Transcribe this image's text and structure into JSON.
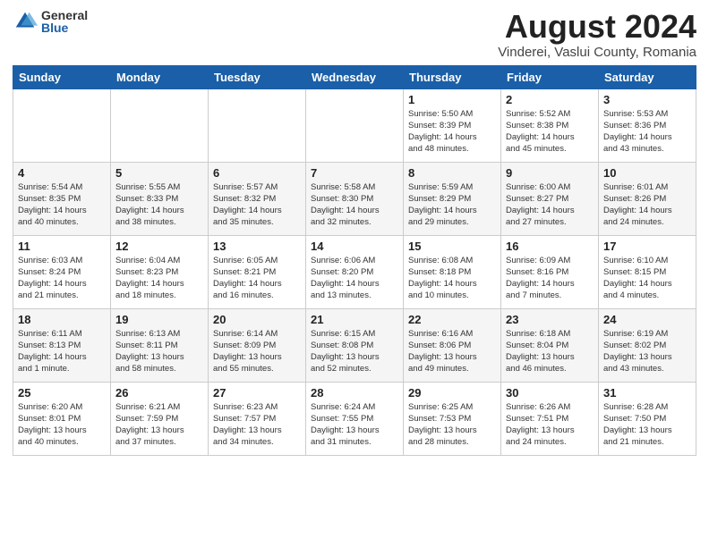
{
  "logo": {
    "general": "General",
    "blue": "Blue"
  },
  "title": "August 2024",
  "subtitle": "Vinderei, Vaslui County, Romania",
  "days_of_week": [
    "Sunday",
    "Monday",
    "Tuesday",
    "Wednesday",
    "Thursday",
    "Friday",
    "Saturday"
  ],
  "weeks": [
    [
      {
        "day": "",
        "info": ""
      },
      {
        "day": "",
        "info": ""
      },
      {
        "day": "",
        "info": ""
      },
      {
        "day": "",
        "info": ""
      },
      {
        "day": "1",
        "info": "Sunrise: 5:50 AM\nSunset: 8:39 PM\nDaylight: 14 hours\nand 48 minutes."
      },
      {
        "day": "2",
        "info": "Sunrise: 5:52 AM\nSunset: 8:38 PM\nDaylight: 14 hours\nand 45 minutes."
      },
      {
        "day": "3",
        "info": "Sunrise: 5:53 AM\nSunset: 8:36 PM\nDaylight: 14 hours\nand 43 minutes."
      }
    ],
    [
      {
        "day": "4",
        "info": "Sunrise: 5:54 AM\nSunset: 8:35 PM\nDaylight: 14 hours\nand 40 minutes."
      },
      {
        "day": "5",
        "info": "Sunrise: 5:55 AM\nSunset: 8:33 PM\nDaylight: 14 hours\nand 38 minutes."
      },
      {
        "day": "6",
        "info": "Sunrise: 5:57 AM\nSunset: 8:32 PM\nDaylight: 14 hours\nand 35 minutes."
      },
      {
        "day": "7",
        "info": "Sunrise: 5:58 AM\nSunset: 8:30 PM\nDaylight: 14 hours\nand 32 minutes."
      },
      {
        "day": "8",
        "info": "Sunrise: 5:59 AM\nSunset: 8:29 PM\nDaylight: 14 hours\nand 29 minutes."
      },
      {
        "day": "9",
        "info": "Sunrise: 6:00 AM\nSunset: 8:27 PM\nDaylight: 14 hours\nand 27 minutes."
      },
      {
        "day": "10",
        "info": "Sunrise: 6:01 AM\nSunset: 8:26 PM\nDaylight: 14 hours\nand 24 minutes."
      }
    ],
    [
      {
        "day": "11",
        "info": "Sunrise: 6:03 AM\nSunset: 8:24 PM\nDaylight: 14 hours\nand 21 minutes."
      },
      {
        "day": "12",
        "info": "Sunrise: 6:04 AM\nSunset: 8:23 PM\nDaylight: 14 hours\nand 18 minutes."
      },
      {
        "day": "13",
        "info": "Sunrise: 6:05 AM\nSunset: 8:21 PM\nDaylight: 14 hours\nand 16 minutes."
      },
      {
        "day": "14",
        "info": "Sunrise: 6:06 AM\nSunset: 8:20 PM\nDaylight: 14 hours\nand 13 minutes."
      },
      {
        "day": "15",
        "info": "Sunrise: 6:08 AM\nSunset: 8:18 PM\nDaylight: 14 hours\nand 10 minutes."
      },
      {
        "day": "16",
        "info": "Sunrise: 6:09 AM\nSunset: 8:16 PM\nDaylight: 14 hours\nand 7 minutes."
      },
      {
        "day": "17",
        "info": "Sunrise: 6:10 AM\nSunset: 8:15 PM\nDaylight: 14 hours\nand 4 minutes."
      }
    ],
    [
      {
        "day": "18",
        "info": "Sunrise: 6:11 AM\nSunset: 8:13 PM\nDaylight: 14 hours\nand 1 minute."
      },
      {
        "day": "19",
        "info": "Sunrise: 6:13 AM\nSunset: 8:11 PM\nDaylight: 13 hours\nand 58 minutes."
      },
      {
        "day": "20",
        "info": "Sunrise: 6:14 AM\nSunset: 8:09 PM\nDaylight: 13 hours\nand 55 minutes."
      },
      {
        "day": "21",
        "info": "Sunrise: 6:15 AM\nSunset: 8:08 PM\nDaylight: 13 hours\nand 52 minutes."
      },
      {
        "day": "22",
        "info": "Sunrise: 6:16 AM\nSunset: 8:06 PM\nDaylight: 13 hours\nand 49 minutes."
      },
      {
        "day": "23",
        "info": "Sunrise: 6:18 AM\nSunset: 8:04 PM\nDaylight: 13 hours\nand 46 minutes."
      },
      {
        "day": "24",
        "info": "Sunrise: 6:19 AM\nSunset: 8:02 PM\nDaylight: 13 hours\nand 43 minutes."
      }
    ],
    [
      {
        "day": "25",
        "info": "Sunrise: 6:20 AM\nSunset: 8:01 PM\nDaylight: 13 hours\nand 40 minutes."
      },
      {
        "day": "26",
        "info": "Sunrise: 6:21 AM\nSunset: 7:59 PM\nDaylight: 13 hours\nand 37 minutes."
      },
      {
        "day": "27",
        "info": "Sunrise: 6:23 AM\nSunset: 7:57 PM\nDaylight: 13 hours\nand 34 minutes."
      },
      {
        "day": "28",
        "info": "Sunrise: 6:24 AM\nSunset: 7:55 PM\nDaylight: 13 hours\nand 31 minutes."
      },
      {
        "day": "29",
        "info": "Sunrise: 6:25 AM\nSunset: 7:53 PM\nDaylight: 13 hours\nand 28 minutes."
      },
      {
        "day": "30",
        "info": "Sunrise: 6:26 AM\nSunset: 7:51 PM\nDaylight: 13 hours\nand 24 minutes."
      },
      {
        "day": "31",
        "info": "Sunrise: 6:28 AM\nSunset: 7:50 PM\nDaylight: 13 hours\nand 21 minutes."
      }
    ]
  ]
}
